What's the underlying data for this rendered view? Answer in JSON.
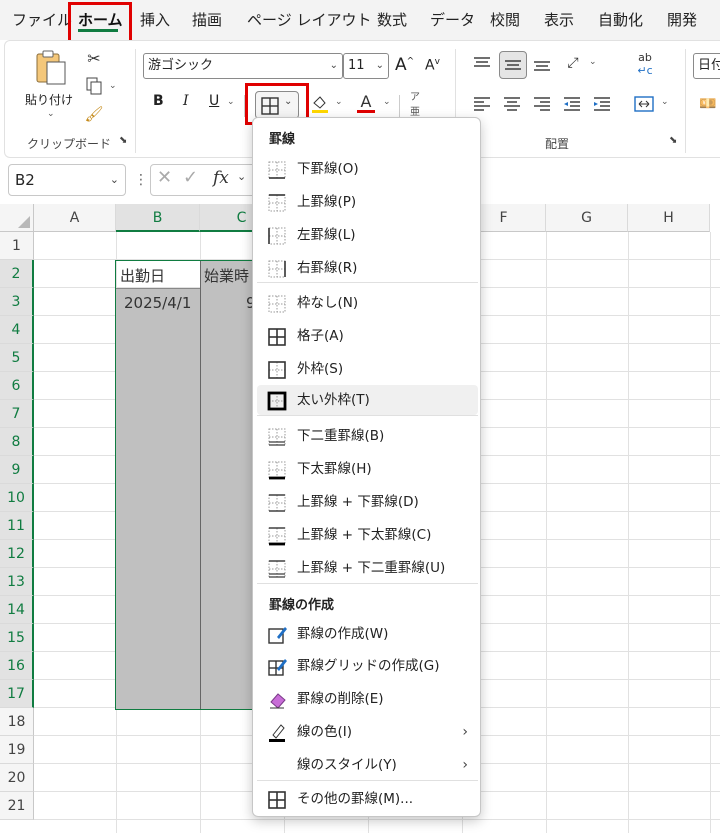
{
  "menu": {
    "tabs": [
      "ファイル",
      "ホーム",
      "挿入",
      "描画",
      "ページ レイアウト",
      "数式",
      "データ",
      "校閲",
      "表示",
      "自動化",
      "開発"
    ]
  },
  "ribbon": {
    "paste_label": "貼り付け",
    "clipboard_label": "クリップボード",
    "font_name": "游ゴシック",
    "font_size": "11",
    "bold": "B",
    "italic": "I",
    "underline": "U",
    "alignment_label": "配置",
    "number_format": "日付"
  },
  "formula_bar": {
    "name_box": "B2",
    "fx": "fx"
  },
  "sheet": {
    "columns": [
      "A",
      "B",
      "C",
      "D",
      "E",
      "F",
      "G",
      "H"
    ],
    "rows": [
      "1",
      "2",
      "3",
      "4",
      "5",
      "6",
      "7",
      "8",
      "9",
      "10",
      "11",
      "12",
      "13",
      "14",
      "15",
      "16",
      "17",
      "18",
      "19",
      "20",
      "21"
    ],
    "b2": "出勤日",
    "c2": "始業時",
    "b3": "2025/4/1",
    "c3": "9"
  },
  "dropdown": {
    "section1": "罫線",
    "section2": "罫線の作成",
    "items": [
      {
        "label": "下罫線(O)",
        "icon": "border-bottom-icon"
      },
      {
        "label": "上罫線(P)",
        "icon": "border-top-icon"
      },
      {
        "label": "左罫線(L)",
        "icon": "border-left-icon"
      },
      {
        "label": "右罫線(R)",
        "icon": "border-right-icon"
      },
      {
        "label": "枠なし(N)",
        "icon": "no-border-icon"
      },
      {
        "label": "格子(A)",
        "icon": "all-borders-icon"
      },
      {
        "label": "外枠(S)",
        "icon": "outside-borders-icon"
      },
      {
        "label": "太い外枠(T)",
        "icon": "thick-outside-borders-icon"
      },
      {
        "label": "下二重罫線(B)",
        "icon": "double-bottom-border-icon"
      },
      {
        "label": "下太罫線(H)",
        "icon": "thick-bottom-border-icon"
      },
      {
        "label": "上罫線 + 下罫線(D)",
        "icon": "top-bottom-border-icon"
      },
      {
        "label": "上罫線 + 下太罫線(C)",
        "icon": "top-thick-bottom-border-icon"
      },
      {
        "label": "上罫線 + 下二重罫線(U)",
        "icon": "top-double-bottom-border-icon"
      }
    ],
    "draw_items": [
      {
        "label": "罫線の作成(W)",
        "icon": "draw-border-icon"
      },
      {
        "label": "罫線グリッドの作成(G)",
        "icon": "draw-border-grid-icon"
      },
      {
        "label": "罫線の削除(E)",
        "icon": "eraser-icon"
      },
      {
        "label": "線の色(I)",
        "icon": "line-color-icon"
      },
      {
        "label": "線のスタイル(Y)",
        "icon": "line-style-icon"
      },
      {
        "label": "その他の罫線(M)...",
        "icon": "more-borders-icon"
      }
    ]
  },
  "colors": {
    "accent": "#107c41",
    "highlight": "#e00000",
    "selection_gray": "#c0c0c0"
  }
}
